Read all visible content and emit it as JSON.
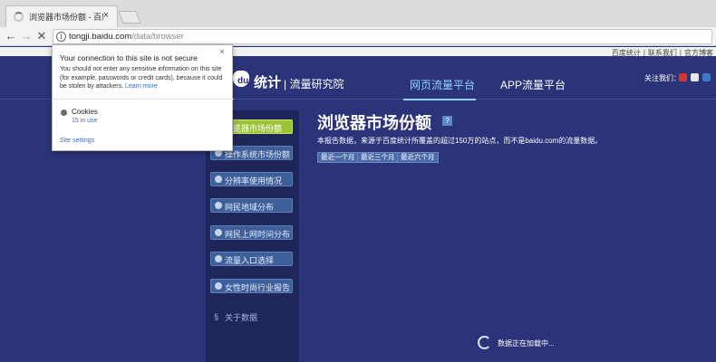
{
  "browser": {
    "tab": {
      "title": "浏览器市场份额 - 百度统",
      "close": "×"
    },
    "nav": {
      "back": "←",
      "forward": "→",
      "stop": "✕"
    },
    "url": {
      "host": "tongji.baidu.com",
      "path": "/data/browser"
    }
  },
  "security_popup": {
    "close": "×",
    "heading": "Your connection to this site is not secure",
    "body": "You should not enter any sensitive information on this site (for example, passwords or credit cards), because it could be stolen by attackers.",
    "learn_more": "Learn more",
    "cookies_label": "Cookies",
    "cookies_count": "15 in use",
    "site_settings": "Site settings"
  },
  "site": {
    "top_links": [
      "百度统计",
      "联系我们",
      "官方博客"
    ],
    "logo_text": "统计",
    "logo_subtitle": "| 流量研究院",
    "nav": {
      "web": "网页流量平台",
      "app": "APP流量平台"
    },
    "follow_label": "关注我们：",
    "social_colors": [
      "#d9362b",
      "#e5e5e5",
      "#3b7ac7"
    ],
    "menu": [
      {
        "label": "浏览器市场份额",
        "icon": "pie-chart-icon",
        "active": true
      },
      {
        "label": "操作系统市场份额",
        "icon": "os-icon",
        "active": false
      },
      {
        "label": "分辨率使用情况",
        "icon": "monitor-icon",
        "active": false
      },
      {
        "label": "网民地域分布",
        "icon": "globe-icon",
        "active": false
      },
      {
        "label": "网民上网时间分布",
        "icon": "clock-icon",
        "active": false
      },
      {
        "label": "流量入口选择",
        "icon": "entry-icon",
        "active": false
      },
      {
        "label": "女性时尚行业报告",
        "icon": "report-icon",
        "active": false
      }
    ],
    "about": "关于数据",
    "main_title": "浏览器市场份额",
    "help": "?",
    "report_note": "本报告数据，来源于百度统计所覆盖的超过150万的站点，而不是baidu.com的流量数据。",
    "period_buttons": [
      "最近一个月",
      "最近三个月",
      "最近六个月"
    ],
    "loading_text": "数据正在加载中..."
  }
}
